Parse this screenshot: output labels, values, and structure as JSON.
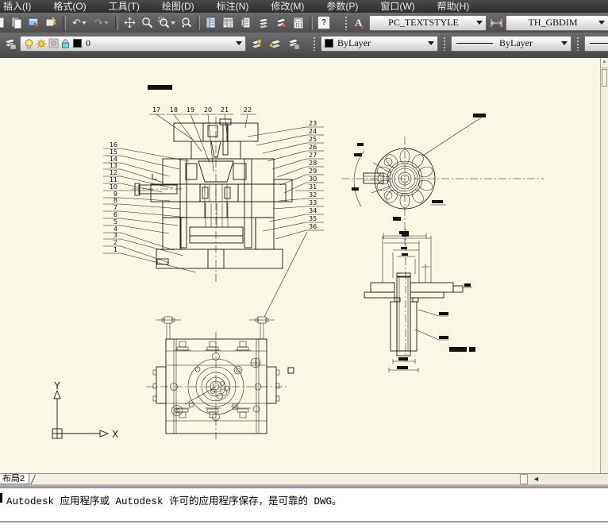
{
  "menu": {
    "items": [
      "插入(I)",
      "格式(O)",
      "工具(T)",
      "绘图(D)",
      "标注(N)",
      "修改(M)",
      "参数(P)",
      "窗口(W)",
      "帮助(H)"
    ]
  },
  "toolbars": {
    "icons": {
      "undo_glyph": "↶",
      "redo_glyph": "↷",
      "help_glyph": "?",
      "text_style_glyph": "A"
    },
    "text_style": {
      "value": "PC_TEXTSTYLE"
    },
    "dim_style": {
      "value": "TH_GBDIM"
    },
    "layer": {
      "current": "0"
    },
    "color": {
      "value": "ByLayer"
    },
    "linetype": {
      "value": "ByLayer"
    }
  },
  "drawing": {
    "parts_top": [
      "17",
      "18",
      "19",
      "20",
      "21",
      "22"
    ],
    "parts_left": [
      "16",
      "15",
      "14",
      "13",
      "12",
      "11",
      "10",
      "9",
      "8",
      "7",
      "6",
      "5",
      "4",
      "3",
      "2",
      "1"
    ],
    "parts_right": [
      "23",
      "24",
      "25",
      "26",
      "27",
      "28",
      "29",
      "30",
      "31",
      "32",
      "33",
      "34",
      "35",
      "36"
    ],
    "ucs": {
      "x_label": "X",
      "y_label": "Y"
    }
  },
  "layout_bar": {
    "active_tab": "布局2",
    "scroll_left_glyph": "◄"
  },
  "command_line": {
    "message": "Autodesk 应用程序或 Autodesk 许可的应用程序保存，是可靠的 DWG。"
  }
}
